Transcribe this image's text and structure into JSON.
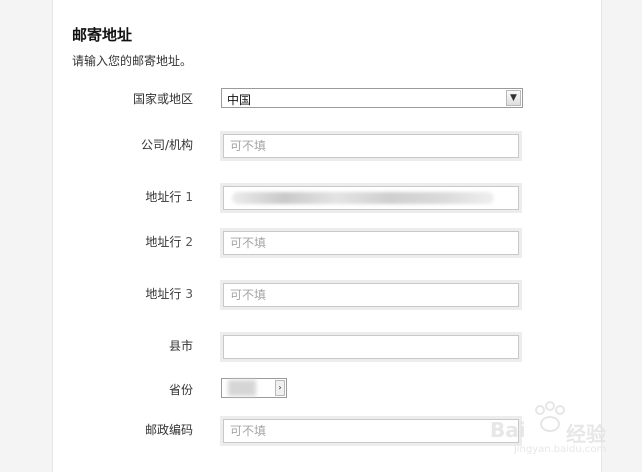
{
  "form": {
    "title": "邮寄地址",
    "subtitle": "请输入您的邮寄地址。",
    "country": {
      "label": "国家或地区",
      "value": "中国",
      "arrow_icon": "chevron-down-icon"
    },
    "company": {
      "label": "公司/机构",
      "placeholder": "可不填"
    },
    "address1": {
      "label": "地址行",
      "num": "1"
    },
    "address2": {
      "label": "地址行",
      "num": "2",
      "placeholder": "可不填"
    },
    "address3": {
      "label": "地址行",
      "num": "3",
      "placeholder": "可不填"
    },
    "city": {
      "label": "县市"
    },
    "province": {
      "label": "省份",
      "arrow_icon": "chevron-right-icon"
    },
    "postal": {
      "label": "邮政编码",
      "placeholder": "可不填"
    }
  },
  "watermark": {
    "brand_left": "Bai",
    "brand_right": "经验",
    "subtitle": "jingyan.baidu.com"
  }
}
